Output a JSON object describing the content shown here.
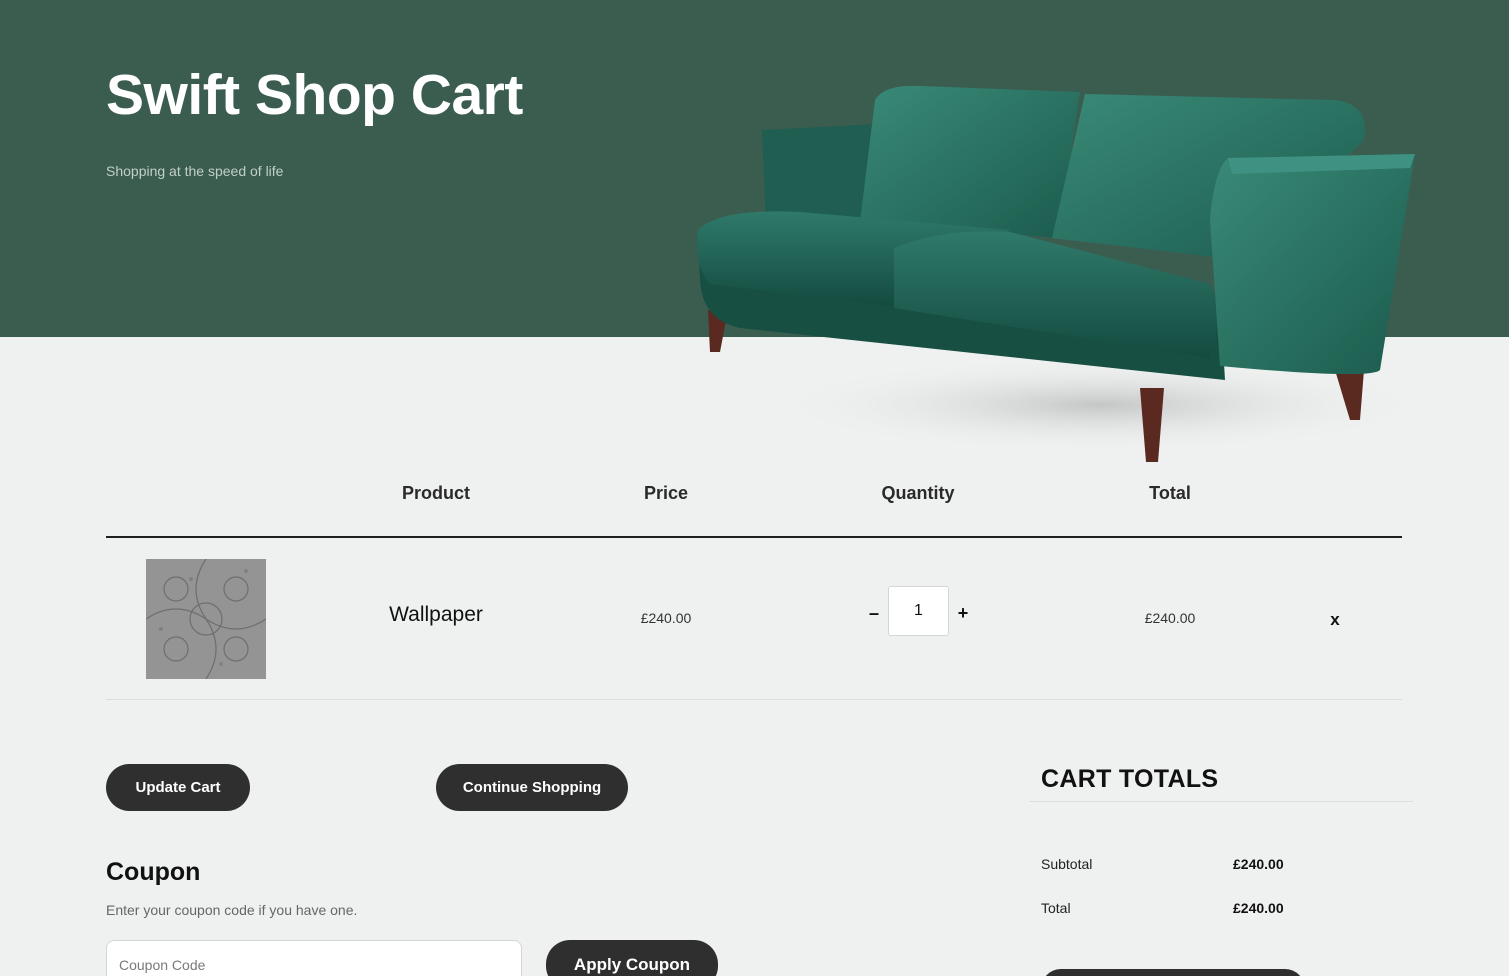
{
  "hero": {
    "title": "Swift Shop Cart",
    "tagline": "Shopping at the speed of life",
    "image": "green-velvet-sofa",
    "background_color": "#3b5d50"
  },
  "cart_table": {
    "headers": [
      "Product",
      "Price",
      "Quantity",
      "Total"
    ],
    "rows": [
      {
        "thumbnail": "wallpaper-swatch",
        "product": "Wallpaper",
        "price": "£240.00",
        "quantity": "1",
        "decrement": "–",
        "increment": "+",
        "total": "£240.00",
        "remove": "x"
      }
    ]
  },
  "actions": {
    "update_cart": "Update Cart",
    "continue_shopping": "Continue Shopping"
  },
  "coupon": {
    "title": "Coupon",
    "help": "Enter your coupon code if you have one.",
    "placeholder": "Coupon Code",
    "apply": "Apply Coupon"
  },
  "totals": {
    "title": "CART TOTALS",
    "subtotal_label": "Subtotal",
    "subtotal_value": "£240.00",
    "total_label": "Total",
    "total_value": "£240.00"
  },
  "colors": {
    "hero": "#3b5d50",
    "button": "#2f2f2f",
    "page": "#eff1f0"
  }
}
